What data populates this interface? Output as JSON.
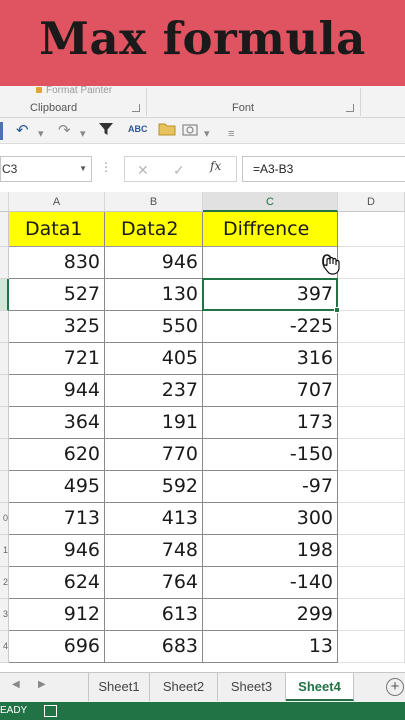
{
  "banner": {
    "title": "Max formula"
  },
  "ribbon": {
    "format_painter": "Format Painter",
    "groups": [
      {
        "label": "Clipboard"
      },
      {
        "label": "Font"
      }
    ]
  },
  "qat": {
    "icons": [
      "excel-icon",
      "undo-icon",
      "redo-icon",
      "filter-icon",
      "spelling-icon",
      "open-folder-icon",
      "camera-icon",
      "customize-qat-icon"
    ]
  },
  "formula_bar": {
    "name_box": "C3",
    "cancel_symbol": "✕",
    "enter_symbol": "✓",
    "fx_label": "fx",
    "formula": "=A3-B3"
  },
  "sheet": {
    "columns": [
      "A",
      "B",
      "C",
      "D"
    ],
    "active_column": "C",
    "row_numbers": [
      "",
      "",
      "",
      "",
      "",
      "",
      "",
      "",
      "",
      "0",
      "1",
      "2",
      "3",
      "4"
    ],
    "headers": [
      "Data1",
      "Data2",
      "Diffrence"
    ],
    "rows": [
      {
        "a": "830",
        "b": "946",
        "c": "0"
      },
      {
        "a": "527",
        "b": "130",
        "c": "397"
      },
      {
        "a": "325",
        "b": "550",
        "c": "-225"
      },
      {
        "a": "721",
        "b": "405",
        "c": "316"
      },
      {
        "a": "944",
        "b": "237",
        "c": "707"
      },
      {
        "a": "364",
        "b": "191",
        "c": "173"
      },
      {
        "a": "620",
        "b": "770",
        "c": "-150"
      },
      {
        "a": "495",
        "b": "592",
        "c": "-97"
      },
      {
        "a": "713",
        "b": "413",
        "c": "300"
      },
      {
        "a": "946",
        "b": "748",
        "c": "198"
      },
      {
        "a": "624",
        "b": "764",
        "c": "-140"
      },
      {
        "a": "912",
        "b": "613",
        "c": "299"
      },
      {
        "a": "696",
        "b": "683",
        "c": "13"
      }
    ]
  },
  "tabs": {
    "sheets": [
      "Sheet1",
      "Sheet2",
      "Sheet3",
      "Sheet4"
    ],
    "active": "Sheet4",
    "add_label": "+"
  },
  "status_bar": {
    "text": "EADY"
  },
  "colors": {
    "banner": "#e05361",
    "header_fill": "#ffff00",
    "excel_green": "#217346"
  }
}
